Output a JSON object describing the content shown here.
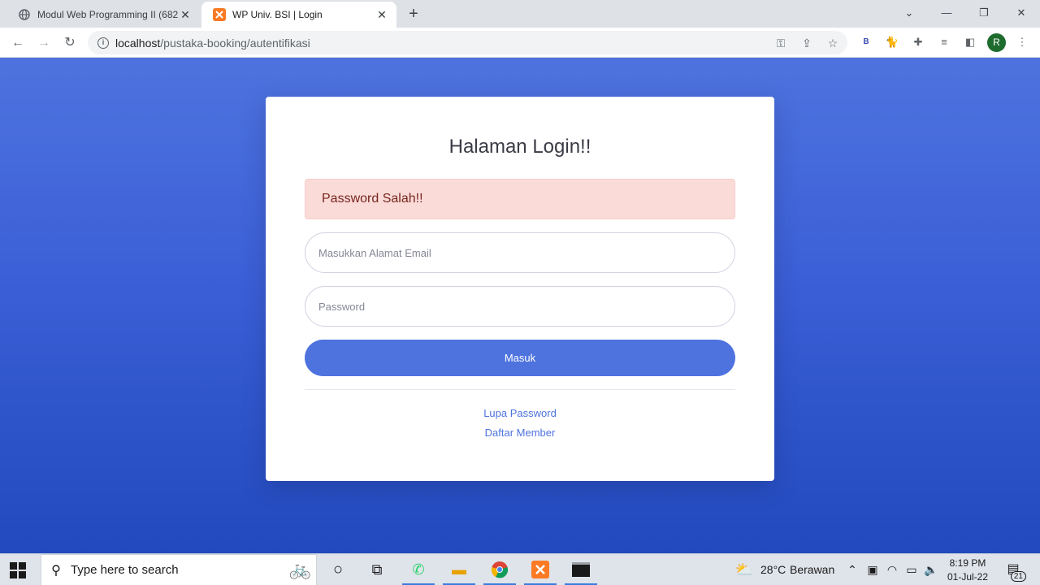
{
  "browser": {
    "tabs": [
      {
        "title": "Modul Web Programming II (682",
        "icon": "globe-icon"
      },
      {
        "title": "WP Univ. BSI | Login",
        "icon": "xampp-icon"
      }
    ],
    "url_host": "localhost",
    "url_path": "/pustaka-booking/autentifikasi",
    "profile_initial": "R",
    "extension_badge": "B"
  },
  "page": {
    "heading": "Halaman Login!!",
    "alert": "Password Salah!!",
    "email_placeholder": "Masukkan Alamat Email",
    "password_placeholder": "Password",
    "submit_label": "Masuk",
    "forgot_link": "Lupa Password",
    "register_link": "Daftar Member",
    "colors": {
      "primary": "#4e73df",
      "alert_bg": "#fadbd8",
      "alert_text": "#78261f"
    }
  },
  "taskbar": {
    "search_placeholder": "Type here to search",
    "weather_temp": "28°C",
    "weather_desc": "Berawan",
    "time": "8:19 PM",
    "date": "01-Jul-22",
    "notification_count": "21"
  }
}
